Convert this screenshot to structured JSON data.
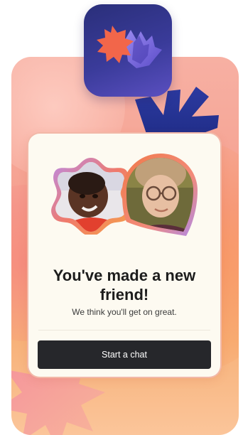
{
  "card": {
    "title": "You've made a new friend!",
    "subtitle": "We think you'll get on great.",
    "cta_label": "Start a chat"
  },
  "icons": {
    "app_icon": "app-logo-icon",
    "burst": "burst-shape-icon",
    "spikes": "spike-shape-icon"
  },
  "colors": {
    "icon_bg": "#2f3388",
    "icon_burst": "#f2664a",
    "icon_fan": "#7a6ae0",
    "button_bg": "#26272b",
    "card_bg": "#fdfaf1",
    "accent_orange": "#f58a4b",
    "accent_purple": "#a98ae8"
  }
}
